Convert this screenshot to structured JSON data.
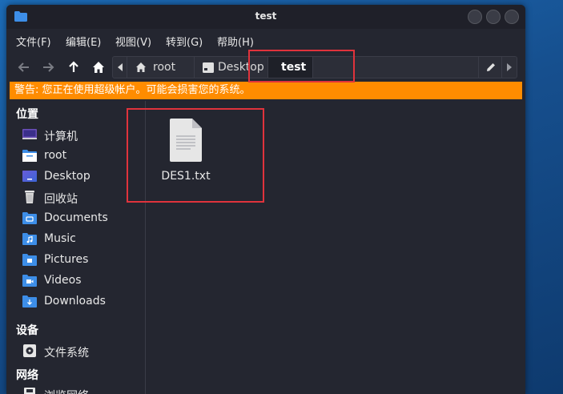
{
  "window": {
    "title": "test",
    "accent": "#ff8c00"
  },
  "menu": {
    "items": [
      "文件(F)",
      "编辑(E)",
      "视图(V)",
      "转到(G)",
      "帮助(H)"
    ]
  },
  "path": {
    "segments": [
      "root",
      "Desktop",
      "test"
    ],
    "current": "test"
  },
  "warning": {
    "text": "警告: 您正在使用超级帐户。可能会损害您的系统。"
  },
  "sidebar": {
    "places_heading": "位置",
    "places": [
      {
        "label": "计算机",
        "icon": "computer-icon"
      },
      {
        "label": "root",
        "icon": "home-folder-icon"
      },
      {
        "label": "Desktop",
        "icon": "desktop-icon"
      },
      {
        "label": "回收站",
        "icon": "trash-icon"
      },
      {
        "label": "Documents",
        "icon": "documents-folder-icon"
      },
      {
        "label": "Music",
        "icon": "music-folder-icon"
      },
      {
        "label": "Pictures",
        "icon": "pictures-folder-icon"
      },
      {
        "label": "Videos",
        "icon": "videos-folder-icon"
      },
      {
        "label": "Downloads",
        "icon": "downloads-folder-icon"
      }
    ],
    "devices_heading": "设备",
    "devices": [
      {
        "label": "文件系统",
        "icon": "drive-icon"
      }
    ],
    "network_heading": "网络",
    "network": [
      {
        "label": "浏览网络",
        "icon": "network-icon"
      }
    ]
  },
  "files": [
    {
      "name": "DES1.txt",
      "icon": "text-file-icon"
    }
  ]
}
